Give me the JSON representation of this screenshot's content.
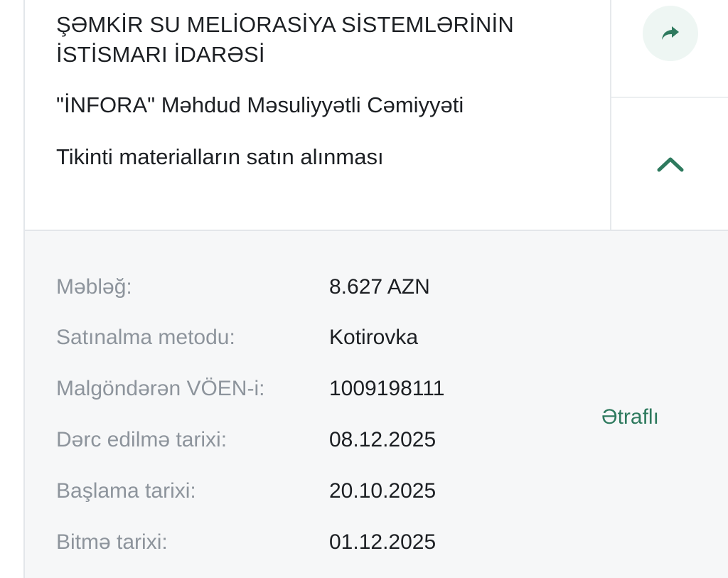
{
  "tender": {
    "organization": "ŞƏMKİR SU MELİORASİYA SİSTEMLƏRİNİN İSTİSMARI İDARƏSİ",
    "supplier": "\"İNFORA\" Məhdud Məsuliyyətli Cəmiyyəti",
    "subject": "Tikinti materialların satın alınması"
  },
  "actions": {
    "share_icon": "share-arrow-icon",
    "collapse_icon": "chevron-up-icon",
    "more_label": "Ətraflı"
  },
  "details": {
    "amount_label": "Məbləğ:",
    "amount_value": "8.627 AZN",
    "method_label": "Satınalma metodu:",
    "method_value": "Kotirovka",
    "supplier_tin_label": "Malgöndərən VÖEN-i:",
    "supplier_tin_value": "1009198111",
    "published_label": "Dərc edilmə tarixi:",
    "published_value": "08.12.2025",
    "start_label": "Başlama tarixi:",
    "start_value": "20.10.2025",
    "end_label": "Bitmə tarixi:",
    "end_value": "01.12.2025"
  },
  "colors": {
    "accent": "#2e7a5e",
    "share_bg": "#eef6f3",
    "details_bg": "#f6f7f8",
    "label_gray": "#8d949c",
    "text_dark": "#1c1f23"
  }
}
